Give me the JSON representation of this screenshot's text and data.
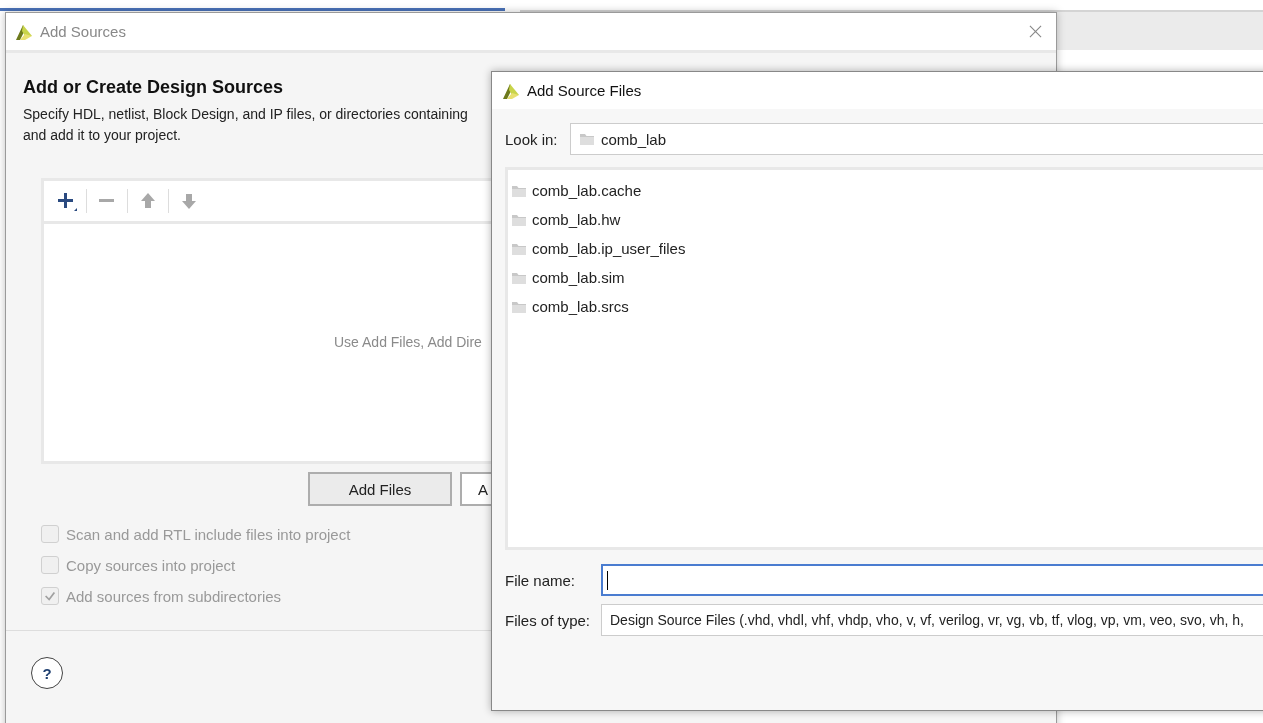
{
  "add_sources": {
    "title": "Add Sources",
    "heading": "Add or Create Design Sources",
    "description": [
      "Specify HDL, netlist, Block Design, and IP files, or directories containing",
      "and add it to your project."
    ],
    "toolbar": [
      {
        "kind": "add",
        "disabled": false
      },
      {
        "kind": "remove",
        "disabled": true
      },
      {
        "kind": "up",
        "disabled": true
      },
      {
        "kind": "down",
        "disabled": true
      }
    ],
    "empty_hint": "Use Add Files, Add Dire",
    "buttons": [
      {
        "label": "Add Files"
      },
      {
        "label": "A"
      }
    ],
    "options": [
      {
        "label": "Scan and add RTL include files into project",
        "checked": false,
        "disabled": true
      },
      {
        "label": "Copy sources into project",
        "checked": false,
        "disabled": true
      },
      {
        "label": "Add sources from subdirectories",
        "checked": true,
        "disabled": true
      }
    ],
    "help": "?"
  },
  "file_dialog": {
    "title": "Add Source Files",
    "look_in": {
      "label": "Look in:",
      "value": "comb_lab"
    },
    "items": [
      {
        "name": "comb_lab.cache"
      },
      {
        "name": "comb_lab.hw"
      },
      {
        "name": "comb_lab.ip_user_files"
      },
      {
        "name": "comb_lab.sim"
      },
      {
        "name": "comb_lab.srcs"
      }
    ],
    "file_name": {
      "label": "File name:",
      "focused": true
    },
    "files_of_type": {
      "label": "Files of type:",
      "value": "Design Source Files (.vhd, vhdl, vhf, vhdp, vho, v, vf, verilog, vr, vg, vb, tf, vlog, vp, vm, veo, svo, vh, h,"
    }
  }
}
